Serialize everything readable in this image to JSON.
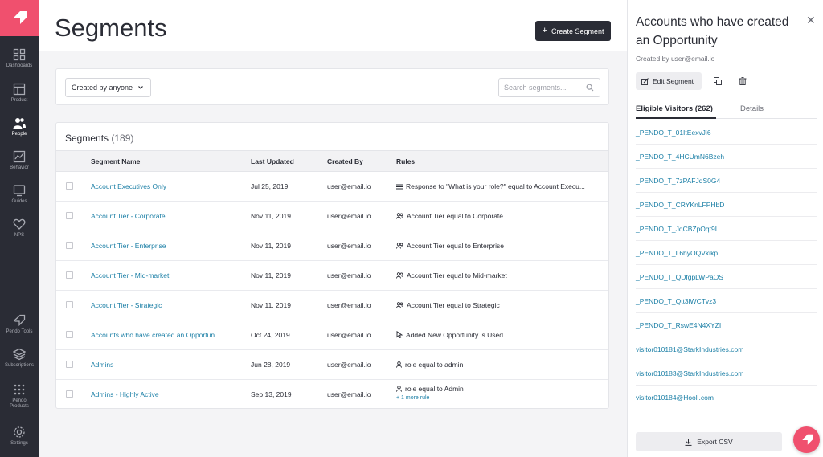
{
  "nav": {
    "items": [
      {
        "label": "Dashboards",
        "icon": "grid-icon"
      },
      {
        "label": "Product",
        "icon": "product-icon"
      },
      {
        "label": "People",
        "icon": "people-icon"
      },
      {
        "label": "Behavior",
        "icon": "chart-icon"
      },
      {
        "label": "Guides",
        "icon": "guide-icon"
      },
      {
        "label": "NPS",
        "icon": "heart-icon"
      },
      {
        "label": "Pendo Tools",
        "icon": "megaphone-icon"
      },
      {
        "label": "Subscriptions",
        "icon": "layers-icon"
      },
      {
        "label": "Pendo Products",
        "icon": "apps-icon"
      },
      {
        "label": "Settings",
        "icon": "gear-icon"
      }
    ],
    "active": "People"
  },
  "header": {
    "title": "Segments",
    "create_label": "Create Segment"
  },
  "filters": {
    "created_by": "Created by anyone",
    "search_placeholder": "Search segments..."
  },
  "table": {
    "title": "Segments",
    "count": "(189)",
    "columns": [
      "Segment Name",
      "Last Updated",
      "Created By",
      "Rules"
    ],
    "rows": [
      {
        "name": "Account Executives Only",
        "updated": "Jul 25, 2019",
        "creator": "user@email.io",
        "rule": "Response to \"What is your role?\" equal to Account Execu...",
        "rule_icon": "list-icon"
      },
      {
        "name": "Account Tier - Corporate",
        "updated": "Nov 11, 2019",
        "creator": "user@email.io",
        "rule": "Account Tier equal to Corporate",
        "rule_icon": "people-icon"
      },
      {
        "name": "Account Tier - Enterprise",
        "updated": "Nov 11, 2019",
        "creator": "user@email.io",
        "rule": "Account Tier equal to Enterprise",
        "rule_icon": "people-icon"
      },
      {
        "name": "Account Tier - Mid-market",
        "updated": "Nov 11, 2019",
        "creator": "user@email.io",
        "rule": "Account Tier equal to Mid-market",
        "rule_icon": "people-icon"
      },
      {
        "name": "Account Tier - Strategic",
        "updated": "Nov 11, 2019",
        "creator": "user@email.io",
        "rule": "Account Tier equal to Strategic",
        "rule_icon": "people-icon"
      },
      {
        "name": "Accounts who have created an Opportun...",
        "updated": "Oct 24, 2019",
        "creator": "user@email.io",
        "rule": "Added New Opportunity is Used",
        "rule_icon": "cursor-icon"
      },
      {
        "name": "Admins",
        "updated": "Jun 28, 2019",
        "creator": "user@email.io",
        "rule": "role equal to admin",
        "rule_icon": "person-icon"
      },
      {
        "name": "Admins - Highly Active",
        "updated": "Sep 13, 2019",
        "creator": "user@email.io",
        "rule": "role equal to Admin",
        "rule_icon": "person-icon",
        "more": "+ 1 more rule"
      }
    ]
  },
  "panel": {
    "title": "Accounts who have created an Opportunity",
    "created_by": "Created by user@email.io",
    "edit_label": "Edit Segment",
    "tabs": [
      "Eligible Visitors (262)",
      "Details"
    ],
    "visitors": [
      "_PENDO_T_01ItEexvJi6",
      "_PENDO_T_4HCUmN6Bzeh",
      "_PENDO_T_7zPAFJqS0G4",
      "_PENDO_T_CRYKnLFPHbD",
      "_PENDO_T_JqCBZpOqt9L",
      "_PENDO_T_L6hyOQVkikp",
      "_PENDO_T_QDfgpLWPaOS",
      "_PENDO_T_Qtt3lWCTvz3",
      "_PENDO_T_RswE4N4XYZI",
      "visitor010181@StarkIndustries.com",
      "visitor010183@StarkIndustries.com",
      "visitor010184@Hooli.com"
    ],
    "export_label": "Export CSV"
  },
  "colors": {
    "brand": "#f0506e",
    "nav_bg": "#2a2c35",
    "link": "#1b7fa6"
  }
}
